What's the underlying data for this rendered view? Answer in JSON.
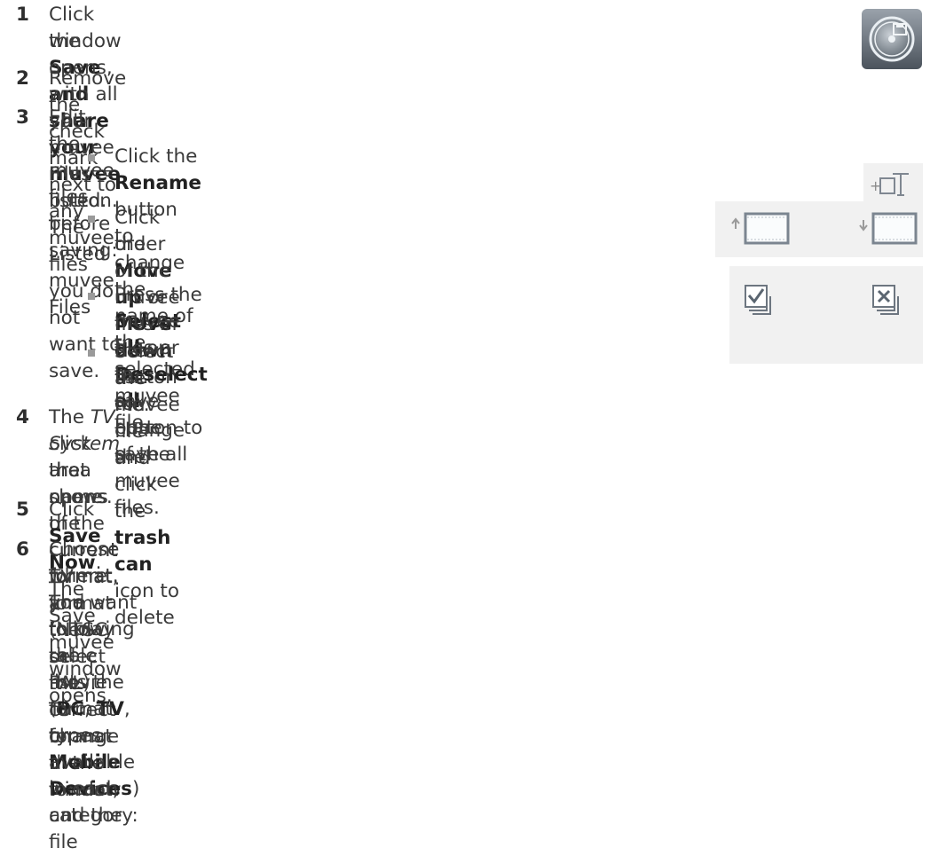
{
  "steps": [
    {
      "num": "1",
      "pre": "Click the ",
      "bold": "Save and share your muvee",
      "post": " button. The Listed muvee Files",
      "line2": "window opens, with all your muvee Files listed."
    },
    {
      "num": "2",
      "text": "Remove the check mark next to any muvee files you do not want to save."
    },
    {
      "num": "3",
      "text": "Edit the muvee files before saving:"
    },
    {
      "num": "4",
      "pre": "The ",
      "ital": "TV System",
      "post": " area shows the current TV format (NTSC or PAL). To change the format,",
      "line2": "click the name of the current format, and then select the correct format in the window",
      "line3": "that opens."
    },
    {
      "num": "5",
      "pre": "Click ",
      "bold": "Save Now",
      "post": ". The Save muvee window opens."
    },
    {
      "num": "6",
      "pre": "Choose where you want to play the movie (",
      "b1": "PC",
      "m1": ", ",
      "b2": "TV",
      "m2": ", or ",
      "b3": "Mobile Devices",
      "post": ") and the file",
      "line2": "format. The following table lists the format types available in each category:"
    }
  ],
  "bullets": [
    {
      "pre": "Click the ",
      "bold": "Rename",
      "post": " button to change the name of the selected muvee file."
    },
    {
      "pre": "Click the ",
      "bold": "Move up",
      "mid": " or ",
      "bold2": "Move down",
      "post": " button to change the",
      "line2": "order of the muvee files in the list."
    },
    {
      "pre": "Press the ",
      "bold": "Select all",
      "mid": " or ",
      "bold2": "Deselect all",
      "post": " button to save all",
      "line2": "muvee files or to save none of the muvee files."
    },
    {
      "pre": "Select a muvee file and click the ",
      "bold": "trash can",
      "post": " icon to delete",
      "line2": "the file."
    }
  ],
  "icons": [
    "save-share-icon",
    "rename-icon",
    "move-up-icon",
    "move-down-icon",
    "select-all-icon",
    "deselect-all-icon"
  ]
}
